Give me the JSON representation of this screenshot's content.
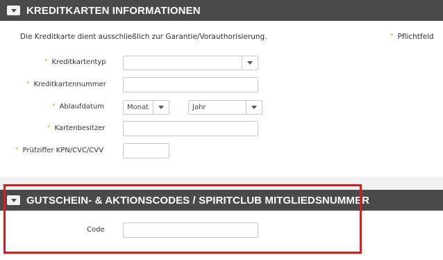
{
  "creditcard": {
    "title": "KREDITKARTEN INFORMATIONEN",
    "intro": "Die Kreditkarte dient ausschließlich zur Garantie/Vorauthorisierung.",
    "required_note": "Pflichtfeld",
    "required_marker": "*",
    "fields": {
      "type": {
        "label": "Kreditkartentyp",
        "value": ""
      },
      "number": {
        "label": "Kreditkartennummer",
        "value": ""
      },
      "expiry": {
        "label": "Ablaufdatum",
        "month_placeholder": "Monat",
        "year_placeholder": "Jahr"
      },
      "holder": {
        "label": "Kartenbesitzer",
        "value": ""
      },
      "cvc": {
        "label": "Prüfziffer KPN/CVC/CVV",
        "value": ""
      }
    }
  },
  "voucher": {
    "title": "GUTSCHEIN- & AKTIONSCODES / SPIRITCLUB MITGLIEDSNUMMER",
    "code_label": "Code",
    "code_value": ""
  },
  "colors": {
    "header_bg": "#4a4a4a",
    "required_star": "#f0a000",
    "highlight": "#dd1b1b"
  }
}
